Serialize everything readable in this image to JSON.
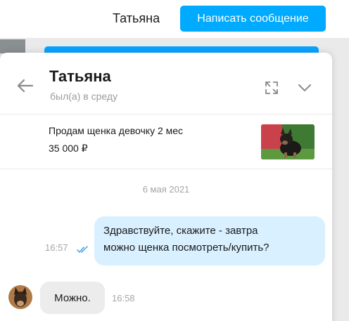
{
  "topbar": {
    "name": "Татьяна",
    "write_button": "Написать сообщение"
  },
  "chat": {
    "title": "Татьяна",
    "status": "был(а) в среду",
    "icons": {
      "back": "arrow-left-icon",
      "expand": "expand-icon",
      "collapse": "chevron-down-icon",
      "read": "double-check-icon"
    },
    "item": {
      "title": "Продам щенка девочку 2 мес",
      "price": "35 000 ₽"
    },
    "date": "6 мая 2021",
    "messages": [
      {
        "direction": "out",
        "lines": [
          "Здравствуйте, скажите - завтра",
          "можно щенка посмотреть/купить?"
        ],
        "time": "16:57"
      },
      {
        "direction": "in",
        "text": "Можно.",
        "time": "16:58"
      }
    ]
  },
  "colors": {
    "accent": "#00aaff",
    "outgoing_bubble": "#d8f0ff",
    "incoming_bubble": "#ececec",
    "muted_text": "#a5a5a5",
    "read_check": "#3aa0e8"
  }
}
